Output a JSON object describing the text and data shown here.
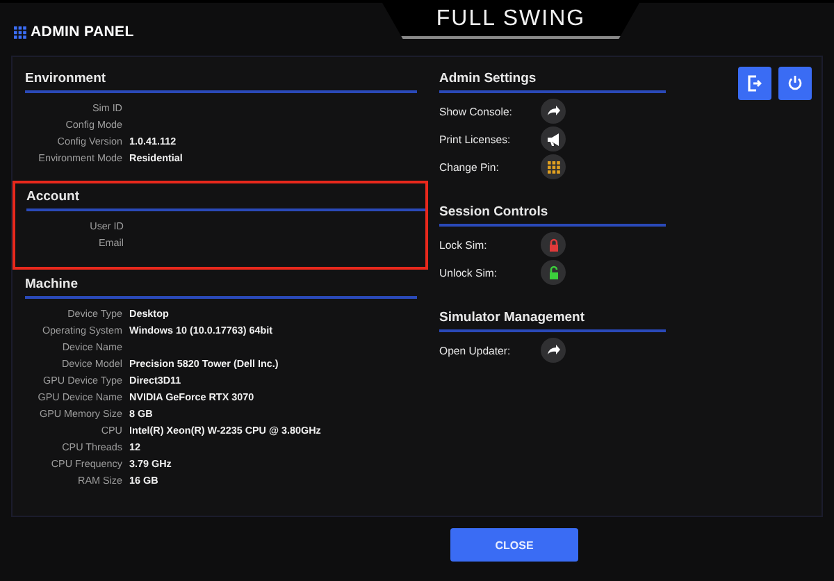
{
  "header": {
    "title": "ADMIN PANEL",
    "logo": "FULL SWING"
  },
  "left_sections": [
    {
      "title": "Environment",
      "highlighted": false,
      "rows": [
        {
          "label": "Sim ID"
        },
        {
          "label": "Config Mode"
        },
        {
          "label": "Config Version",
          "value": "1.0.41.112"
        },
        {
          "label": "Environment Mode",
          "value": "Residential"
        }
      ]
    },
    {
      "title": "Account",
      "highlighted": true,
      "rows": [
        {
          "label": "User ID"
        },
        {
          "label": "Email"
        }
      ]
    },
    {
      "title": "Machine",
      "highlighted": false,
      "rows": [
        {
          "label": "Device Type",
          "value": "Desktop"
        },
        {
          "label": "Operating System",
          "value": "Windows 10  (10.0.17763) 64bit"
        },
        {
          "label": "Device Name"
        },
        {
          "label": "Device Model",
          "value": "Precision 5820 Tower (Dell Inc.)"
        },
        {
          "label": "GPU Device Type",
          "value": "Direct3D11"
        },
        {
          "label": "GPU Device Name",
          "value": "NVIDIA GeForce RTX 3070"
        },
        {
          "label": "GPU Memory Size",
          "value": "8 GB"
        },
        {
          "label": "CPU",
          "value": "Intel(R) Xeon(R) W-2235 CPU @ 3.80GHz"
        },
        {
          "label": "CPU Threads",
          "value": "12"
        },
        {
          "label": "CPU Frequency",
          "value": "3.79 GHz"
        },
        {
          "label": "RAM Size",
          "value": "16 GB"
        }
      ]
    }
  ],
  "right_sections": [
    {
      "title": "Admin Settings",
      "actions": [
        {
          "label": "Show Console:",
          "kind": "arrow"
        },
        {
          "label": "Print Licenses:",
          "kind": "megaphone"
        },
        {
          "label": "Change Pin:",
          "kind": "keypad"
        }
      ]
    },
    {
      "title": "Session Controls",
      "actions": [
        {
          "label": "Lock Sim:",
          "kind": "lock"
        },
        {
          "label": "Unlock Sim:",
          "kind": "unlock"
        }
      ]
    },
    {
      "title": "Simulator Management",
      "actions": [
        {
          "label": "Open Updater:",
          "kind": "arrow"
        }
      ]
    }
  ],
  "top_buttons": [
    {
      "kind": "exit"
    },
    {
      "kind": "power"
    }
  ],
  "close_button": "CLOSE"
}
